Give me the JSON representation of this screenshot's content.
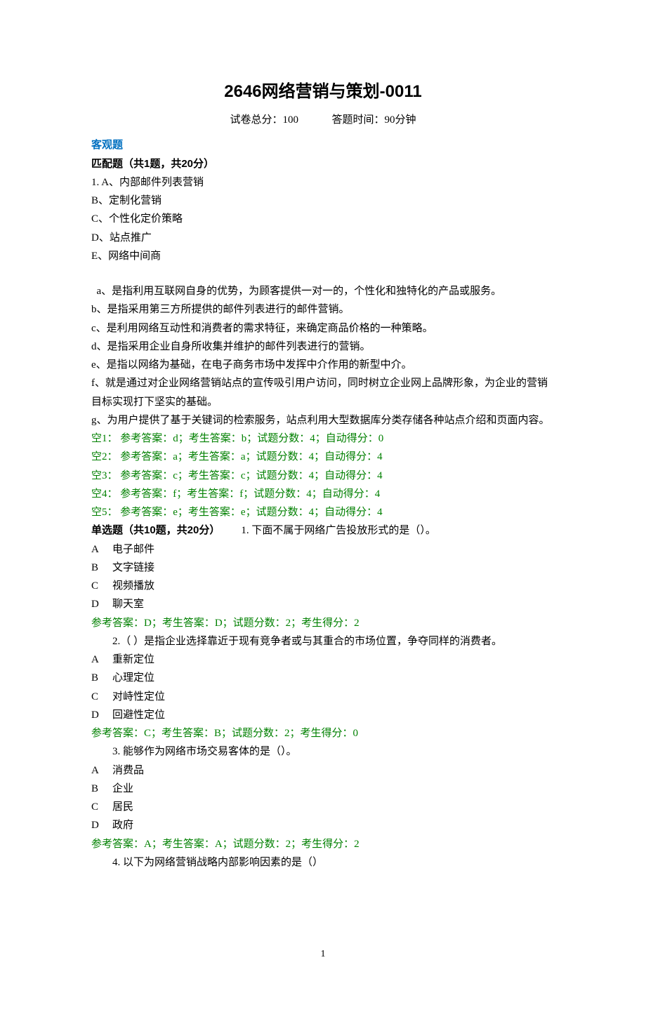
{
  "title": "2646网络营销与策划-0011",
  "meta": {
    "total_score_label": "试卷总分：100",
    "time_label": "答题时间：90分钟"
  },
  "section_objective": "客观题",
  "matching": {
    "header": "匹配题（共1题，共20分）",
    "q1_prefix": "1. ",
    "options": {
      "A": "A、内部邮件列表营销",
      "B": "B、定制化营销",
      "C": "C、个性化定价策略",
      "D": "D、站点推广",
      "E": "E、网络中间商"
    },
    "descs": {
      "a": "  a、是指利用互联网自身的优势，为顾客提供一对一的，个性化和独特化的产品或服务。",
      "b": "b、是指采用第三方所提供的邮件列表进行的邮件营销。",
      "c": "c、是利用网络互动性和消费者的需求特征，来确定商品价格的一种策略。",
      "d": "d、是指采用企业自身所收集并维护的邮件列表进行的营销。",
      "e": "e、是指以网络为基础，在电子商务市场中发挥中介作用的新型中介。",
      "f": "f、就是通过对企业网络营销站点的宣传吸引用户访问，同时树立企业网上品牌形象，为企业的营销目标实现打下坚实的基础。",
      "g": "g、为用户提供了基于关键词的检索服务，站点利用大型数据库分类存储各种站点介绍和页面内容。"
    },
    "blanks": {
      "1": "空1：  参考答案：d；考生答案：b；试题分数：4；自动得分：0",
      "2": "空2：  参考答案：a；考生答案：a；试题分数：4；自动得分：4",
      "3": "空3：  参考答案：c；考生答案：c；试题分数：4；自动得分：4",
      "4": "空4：  参考答案：f；考生答案：f；试题分数：4；自动得分：4",
      "5": "空5：  参考答案：e；考生答案：e；试题分数：4；自动得分：4"
    }
  },
  "single": {
    "header": "单选题（共10题，共20分）",
    "q1": {
      "stem": "1.  下面不属于网络广告投放形式的是（）。",
      "A": "电子邮件",
      "B": "文字链接",
      "C": "视频播放",
      "D": "聊天室",
      "ans": "参考答案：D；考生答案：D；试题分数：2；考生得分：2"
    },
    "q2": {
      "stem": "2.（ ）是指企业选择靠近于现有竞争者或与其重合的市场位置，争夺同样的消费者。",
      "A": "重新定位",
      "B": "心理定位",
      "C": "对峙性定位",
      "D": "回避性定位",
      "ans": "参考答案：C；考生答案：B；试题分数：2；考生得分：0"
    },
    "q3": {
      "stem": "3.  能够作为网络市场交易客体的是（）。",
      "A": "消费品",
      "B": "企业",
      "C": "居民",
      "D": "政府",
      "ans": "参考答案：A；考生答案：A；试题分数：2；考生得分：2"
    },
    "q4": {
      "stem": "4.  以下为网络营销战略内部影响因素的是（）"
    }
  },
  "letters": {
    "A": "A",
    "B": "B",
    "C": "C",
    "D": "D"
  },
  "page_number": "1"
}
